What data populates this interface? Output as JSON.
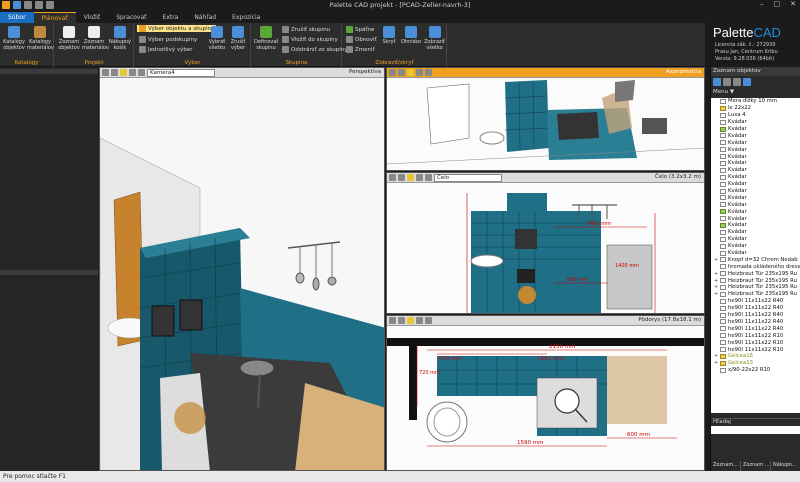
{
  "window": {
    "title": "Palette CAD projekt - [PCAD-Zeller-navrh-3]"
  },
  "ribbon_tabs": [
    "Súbor",
    "Plánovať",
    "Vložiť",
    "Spracovať",
    "Extra",
    "Náhľad",
    "Expozícia"
  ],
  "ribbon": {
    "katalogy": {
      "label": "Katalógy",
      "btn1": "Katalógy objektov",
      "btn2": "Katalógy materiálov"
    },
    "projekt": {
      "label": "Projekt",
      "btn1": "Zoznam objektov",
      "btn2": "Zoznam materiálov",
      "btn3": "Nákupný košík"
    },
    "vyber": {
      "label": "Výber",
      "opt1": "Výber objektu a skupiny",
      "opt2": "Výber podskupiny",
      "opt3": "Jednotlivý výber",
      "btn1": "Vybrať všetko",
      "btn2": "Zrušiť výber"
    },
    "skupina": {
      "label": "Skupina",
      "btn1": "Definovať skupinu",
      "opt1": "Zrušiť skupinu",
      "opt2": "Vložiť do skupiny",
      "opt3": "Odstrániť zo skupiny"
    },
    "zobrazit": {
      "label": "Zobraziť/skryť",
      "opt1": "Späťne",
      "opt2": "Obnoviť",
      "opt3": "Zmeniť",
      "btn1": "Skryť",
      "btn2": "Ohnisko",
      "btn3": "Zobraziť všetko"
    }
  },
  "brand": {
    "name_a": "Palette",
    "name_b": "CAD",
    "license": "Licencia zák. č.: 272939",
    "user": "Prasu Jan, Centrum Kribu",
    "version": "Verzia: 9.28.036 (64bit)"
  },
  "viewports": {
    "perspective": {
      "camera": "Kamera4",
      "label": "Perspektíva"
    },
    "axon": {
      "label": "Axonometria"
    },
    "front": {
      "select": "Čelo",
      "label": "Čelo  (3.2x3.2 m)"
    },
    "plan": {
      "label": "Pôdorys  (17.8x18.1 m)"
    }
  },
  "dims": {
    "front_1491": "1491 mm",
    "front_600": "600 mm",
    "front_1400": "1400 mm",
    "plan_2150": "2150 mm",
    "plan_1491": "1491 mm",
    "plan_470": "470 mm",
    "plan_720": "720 mm",
    "plan_1590": "1590 mm",
    "plan_600": "600 mm"
  },
  "object_panel": {
    "title": "Zoznam objektov",
    "menu": "Menu",
    "items": [
      {
        "text": "Mera dĺžky 10 mm",
        "icon": "file",
        "exp": ""
      },
      {
        "text": "le 22x22",
        "icon": "yellow",
        "exp": ""
      },
      {
        "text": "Luxa 4",
        "icon": "file",
        "exp": ""
      },
      {
        "text": "Kvádar",
        "icon": "file",
        "exp": ""
      },
      {
        "text": "Kvádar",
        "icon": "green",
        "exp": ""
      },
      {
        "text": "Kvádar",
        "icon": "file",
        "exp": ""
      },
      {
        "text": "Kvádar",
        "icon": "file",
        "exp": ""
      },
      {
        "text": "Kvádar",
        "icon": "file",
        "exp": ""
      },
      {
        "text": "Kvádar",
        "icon": "file",
        "exp": ""
      },
      {
        "text": "Kvádar",
        "icon": "file",
        "exp": ""
      },
      {
        "text": "Kvádar",
        "icon": "file",
        "exp": ""
      },
      {
        "text": "Kvádar",
        "icon": "file",
        "exp": ""
      },
      {
        "text": "Kvádar",
        "icon": "file",
        "exp": ""
      },
      {
        "text": "Kvádar",
        "icon": "file",
        "exp": ""
      },
      {
        "text": "Kvádar",
        "icon": "file",
        "exp": ""
      },
      {
        "text": "Kvádar",
        "icon": "file",
        "exp": ""
      },
      {
        "text": "Kvádar",
        "icon": "green",
        "exp": ""
      },
      {
        "text": "Kvádar",
        "icon": "file",
        "exp": ""
      },
      {
        "text": "Kvádar",
        "icon": "green",
        "exp": ""
      },
      {
        "text": "Kvádar",
        "icon": "file",
        "exp": ""
      },
      {
        "text": "Kvádar",
        "icon": "file",
        "exp": ""
      },
      {
        "text": "Kvádar",
        "icon": "file",
        "exp": ""
      },
      {
        "text": "Kvádar",
        "icon": "file",
        "exp": ""
      },
      {
        "text": "Knopf d=32 Chrom Nedab",
        "icon": "file",
        "exp": "+"
      },
      {
        "text": "hromada ukládeného dreva",
        "icon": "file",
        "exp": ""
      },
      {
        "text": "Heizbraut Tür 235x195 Ru",
        "icon": "file",
        "exp": "+"
      },
      {
        "text": "Heizbraut Tür 235x195 Ru",
        "icon": "file",
        "exp": "+"
      },
      {
        "text": "Heizbraut Tür 235x195 Ru",
        "icon": "file",
        "exp": "+"
      },
      {
        "text": "Heizbraut Tür 235x195 Ru",
        "icon": "file",
        "exp": "+"
      },
      {
        "text": "he90I 11x11x22 R40",
        "icon": "file",
        "exp": ""
      },
      {
        "text": "he90I 11x11x22 R40",
        "icon": "file",
        "exp": ""
      },
      {
        "text": "he90I 11x11x22 R40",
        "icon": "file",
        "exp": ""
      },
      {
        "text": "he90I 11x11x22 R40",
        "icon": "file",
        "exp": ""
      },
      {
        "text": "he90I 11x11x22 R40",
        "icon": "file",
        "exp": ""
      },
      {
        "text": "he90I 11x11x22 R10",
        "icon": "file",
        "exp": ""
      },
      {
        "text": "he90I 11x11x22 R10",
        "icon": "file",
        "exp": ""
      },
      {
        "text": "he90I 11x11x22 R10",
        "icon": "file",
        "exp": ""
      },
      {
        "text": "Gelcea16",
        "icon": "yellow",
        "exp": "+",
        "gray": true
      },
      {
        "text": "Gelcea13",
        "icon": "yellow",
        "exp": "+",
        "gray": true
      },
      {
        "text": "x/90-22x22 R10",
        "icon": "file",
        "exp": ""
      }
    ],
    "find_label": "Hľadaj",
    "bottom_tabs": [
      "Zoznam...",
      "Zoznam ...",
      "Nákupn..."
    ]
  },
  "status": {
    "text": "Pre pomoc stlačte F1"
  },
  "colors": {
    "accent": "#f0a020",
    "tile": "#1f6f86",
    "file_tab": "#1a6ec2"
  }
}
